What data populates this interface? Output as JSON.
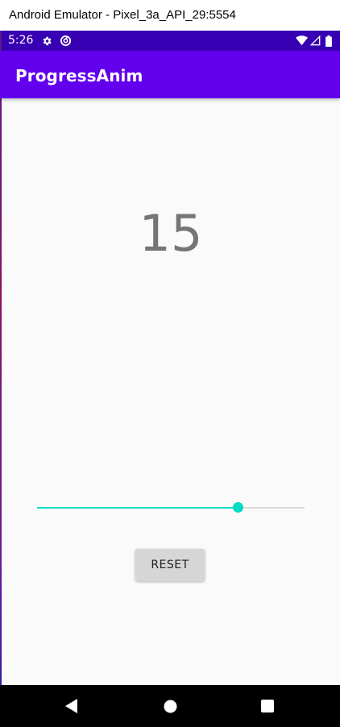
{
  "window": {
    "title": "Android Emulator - Pixel_3a_API_29:5554"
  },
  "status_bar": {
    "time": "5:26",
    "icons": [
      "settings-icon",
      "sync-icon",
      "wifi-icon",
      "signal-icon",
      "battery-icon"
    ]
  },
  "app_bar": {
    "title": "ProgressAnim"
  },
  "main": {
    "count": "15",
    "seekbar": {
      "progress_fraction": 0.75,
      "progress_color": "#03dac5",
      "track_color": "#d9d9d9"
    },
    "reset_label": "RESET"
  },
  "nav_bar": {
    "buttons": [
      "back-icon",
      "home-icon",
      "recents-icon"
    ]
  },
  "colors": {
    "primary": "#6200ee",
    "primary_dark": "#3700b3",
    "accent": "#03dac5"
  }
}
